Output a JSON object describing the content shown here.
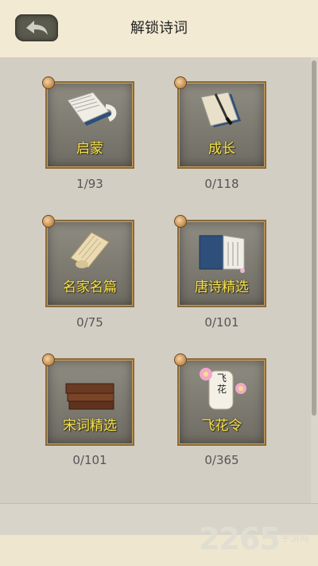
{
  "header": {
    "title": "解锁诗词"
  },
  "categories": [
    {
      "label": "启蒙",
      "progress": "1/93"
    },
    {
      "label": "成长",
      "progress": "0/118"
    },
    {
      "label": "名家名篇",
      "progress": "0/75"
    },
    {
      "label": "唐诗精选",
      "progress": "0/101"
    },
    {
      "label": "宋词精选",
      "progress": "0/101"
    },
    {
      "label": "飞花令",
      "progress": "0/365"
    }
  ],
  "feihua_tag": "飞花",
  "watermark": {
    "number": "2265",
    "suffix": "手游网"
  },
  "icons": {
    "back": "back-arrow-icon",
    "qimeng": "open-book-icon",
    "chengzhang": "book-brush-icon",
    "mingjia": "scroll-icon",
    "tangshi": "folding-book-icon",
    "songci": "stacked-books-icon",
    "feihua": "flower-tag-icon"
  }
}
